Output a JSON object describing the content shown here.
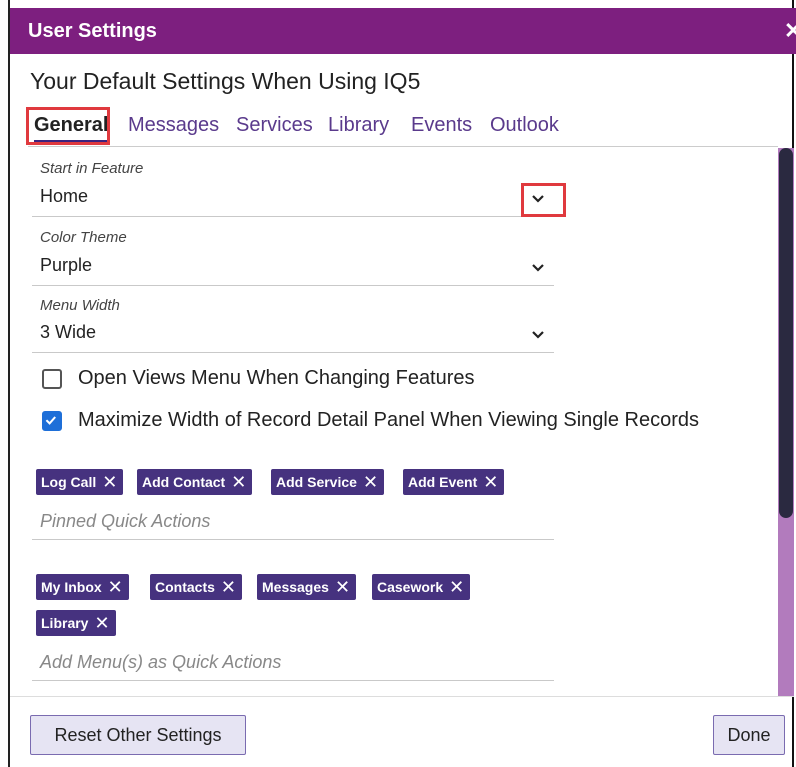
{
  "dialog": {
    "title": "User Settings",
    "close_icon": "close-icon",
    "subtitle": "Your Default Settings When Using IQ5"
  },
  "tabs": [
    {
      "label": "General",
      "active": true
    },
    {
      "label": "Messages"
    },
    {
      "label": "Services"
    },
    {
      "label": "Library"
    },
    {
      "label": "Events"
    },
    {
      "label": "Outlook"
    }
  ],
  "fields": {
    "start_in_feature": {
      "label": "Start in Feature",
      "value": "Home"
    },
    "color_theme": {
      "label": "Color Theme",
      "value": "Purple"
    },
    "menu_width": {
      "label": "Menu Width",
      "value": "3 Wide"
    }
  },
  "checkboxes": [
    {
      "label": "Open Views Menu When Changing Features",
      "checked": false
    },
    {
      "label": "Maximize Width of Record Detail Panel When Viewing Single Records",
      "checked": true
    }
  ],
  "pinned_quick_actions": {
    "chips": [
      "Log Call",
      "Add Contact",
      "Add Service",
      "Add Event"
    ],
    "placeholder": "Pinned Quick Actions"
  },
  "menu_quick_actions": {
    "chips": [
      "My Inbox",
      "Contacts",
      "Messages",
      "Casework",
      "Library"
    ],
    "placeholder": "Add Menu(s) as Quick Actions"
  },
  "buttons": {
    "reset": "Reset Other Settings",
    "done": "Done"
  },
  "colors": {
    "title_bar": "#7d1f7f",
    "chip": "#46327f",
    "highlight": "#e0393e",
    "checkbox": "#1e6fd8"
  }
}
